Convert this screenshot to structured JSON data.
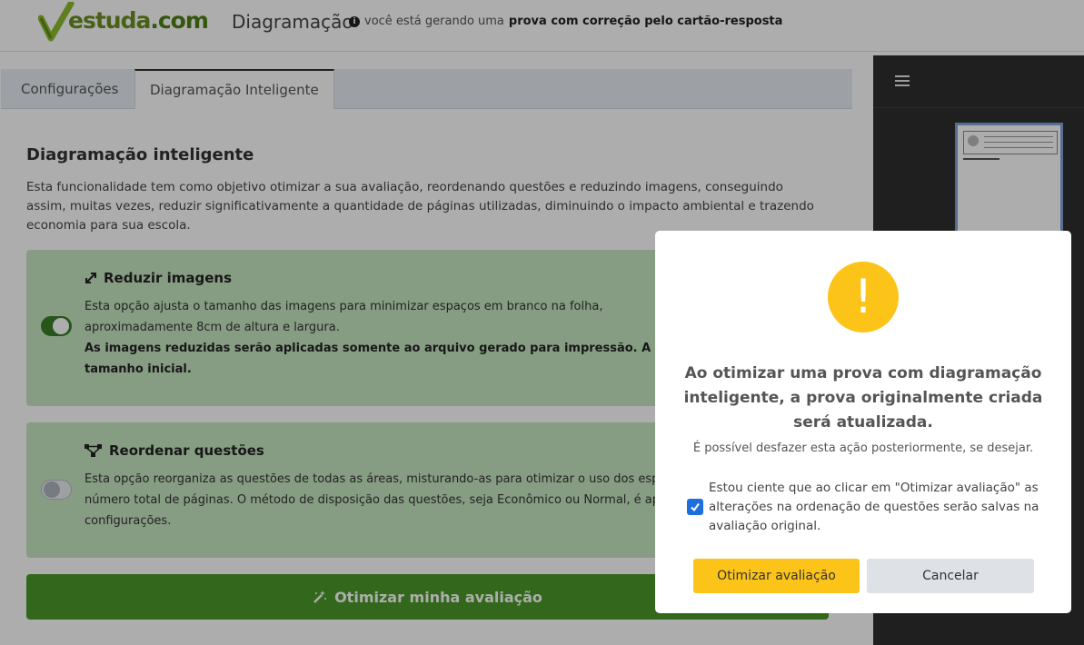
{
  "header": {
    "logo_text_1": "estuda",
    "logo_text_2": ".com",
    "title": "Diagramação",
    "note_prefix": "você está gerando uma",
    "note_bold": "prova com correção pelo cartão-resposta"
  },
  "tabs": [
    {
      "label": "Configurações"
    },
    {
      "label": "Diagramação Inteligente"
    }
  ],
  "section": {
    "title": "Diagramação inteligente",
    "description": "Esta funcionalidade tem como objetivo otimizar a sua avaliação, reordenando questões e reduzindo imagens, conseguindo assim, muitas vezes, reduzir significativamente a quantidade de páginas utilizadas, diminuindo o impacto ambiental e trazendo economia para sua escola."
  },
  "cards": [
    {
      "title": "Reduzir imagens",
      "icon": "expand-arrows-icon",
      "enabled": true,
      "text": "Esta opção ajusta o tamanho das imagens para minimizar espaços em branco na folha,",
      "text_2": "aproximadamente 8cm de altura e largura.",
      "text_bold": "As imagens reduzidas serão aplicadas somente ao arquivo gerado para impressão. A avaliação o",
      "text_bold_2": "tamanho inicial."
    },
    {
      "title": "Reordenar questões",
      "icon": "sitemap-icon",
      "enabled": false,
      "text": "Esta opção reorganiza as questões de todas as áreas, misturando-as para otimizar o uso dos espa",
      "text_2": "número total de páginas. O método de disposição das questões, seja Econômico ou Normal, é aplic",
      "text_3": "configurações."
    }
  ],
  "optimize_button": "Otimizar minha avaliação",
  "modal": {
    "icon": "!",
    "title": "Ao otimizar uma prova com diagramação inteligente, a prova originalmente criada será atualizada.",
    "subtitle": "É possível desfazer esta ação posteriormente, se desejar.",
    "checkbox_checked": true,
    "checkbox_label": "Estou ciente que ao clicar em \"Otimizar avaliação\" as alterações na ordenação de questões serão salvas na avaliação original.",
    "confirm_label": "Otimizar avaliação",
    "cancel_label": "Cancelar"
  },
  "colors": {
    "brand_green": "#4c9a2a",
    "card_green": "#c7e8c2",
    "warning_yellow": "#fcc419",
    "checkbox_blue": "#1d6fe0"
  }
}
